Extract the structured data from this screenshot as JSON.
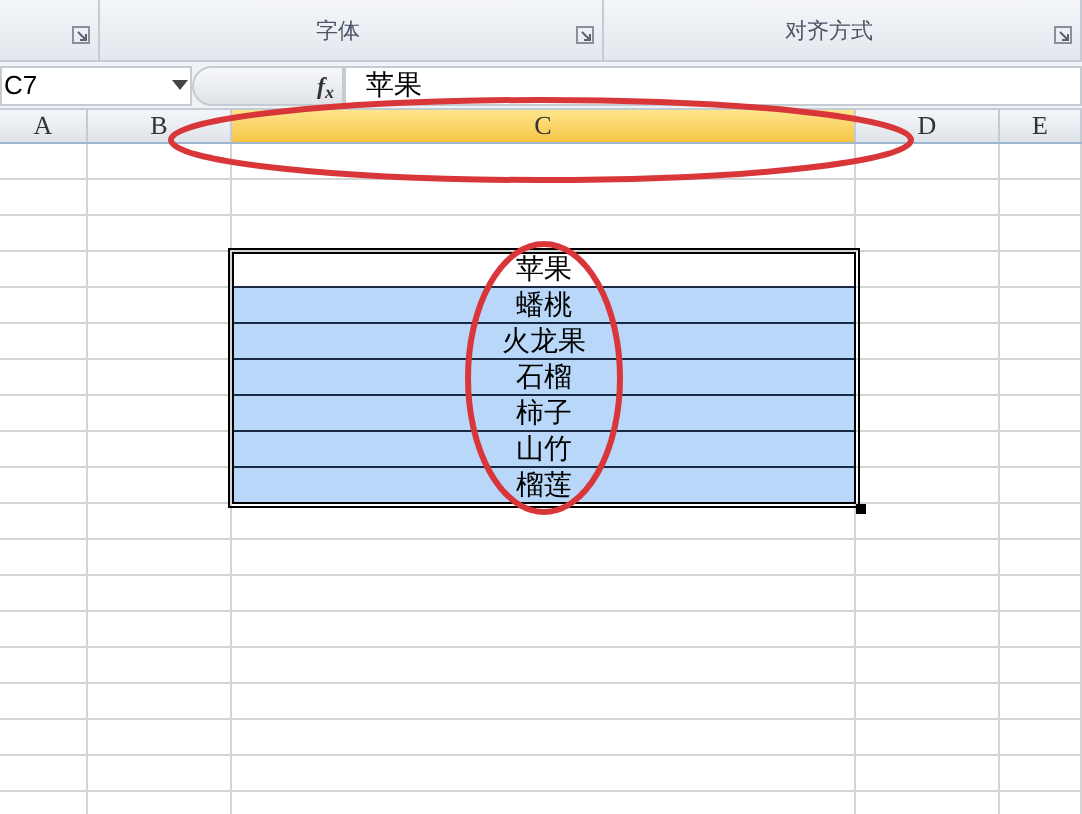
{
  "ribbon": {
    "groups": [
      {
        "label": "字体"
      },
      {
        "label": "对齐方式"
      }
    ]
  },
  "formula_bar": {
    "name_box": "C7",
    "function_button": "f$_{x}$",
    "formula": "苹果"
  },
  "columns": [
    {
      "label": "A",
      "selected": false
    },
    {
      "label": "B",
      "selected": false
    },
    {
      "label": "C",
      "selected": true
    },
    {
      "label": "D",
      "selected": false
    },
    {
      "label": "E",
      "selected": false
    }
  ],
  "cells": [
    {
      "text": "苹果",
      "selected": true,
      "active": true
    },
    {
      "text": "蟠桃",
      "selected": true,
      "active": false
    },
    {
      "text": "火龙果",
      "selected": true,
      "active": false
    },
    {
      "text": "石榴",
      "selected": true,
      "active": false
    },
    {
      "text": "柿子",
      "selected": true,
      "active": false
    },
    {
      "text": "山竹",
      "selected": true,
      "active": false
    },
    {
      "text": "榴莲",
      "selected": true,
      "active": false
    }
  ]
}
